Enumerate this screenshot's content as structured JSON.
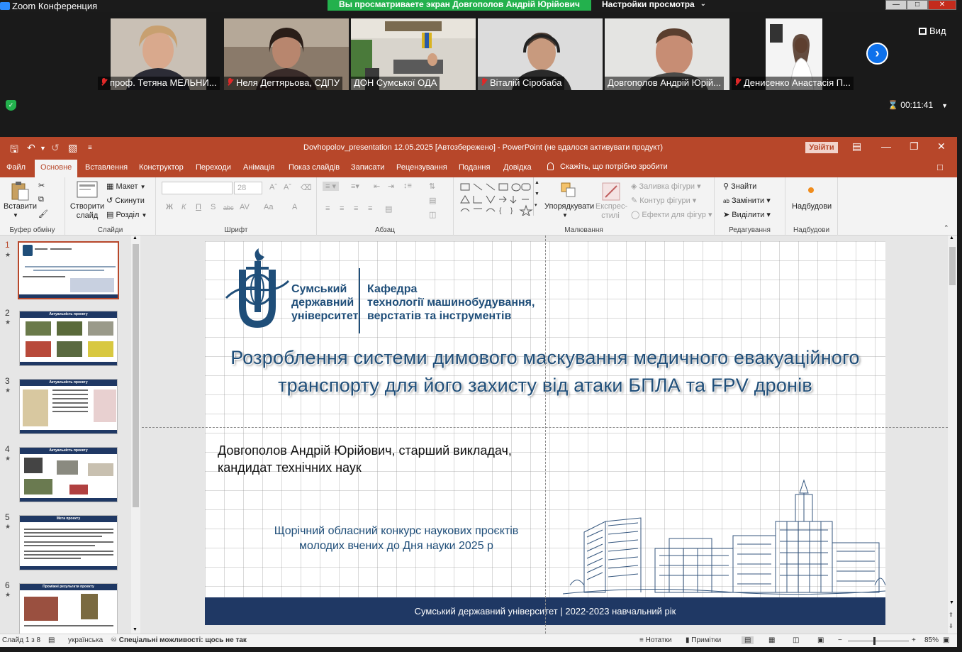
{
  "zoom": {
    "window_title": "Zoom Конференция",
    "share_banner": "Вы просматриваете экран Довгополов Андрій Юрійович",
    "view_options": "Настройки просмотра",
    "view_button": "Вид",
    "timer": "00:11:41",
    "participants": [
      {
        "name": "проф. Тетяна МЕЛЬНИ...",
        "muted": true,
        "active": false
      },
      {
        "name": "Неля Дегтярьова, СДПУ",
        "muted": true,
        "active": false
      },
      {
        "name": "ДОН Сумської ОДА",
        "muted": false,
        "active": false
      },
      {
        "name": "Віталій Сіробаба",
        "muted": true,
        "active": false
      },
      {
        "name": "Довгополов Андрій Юрій...",
        "muted": false,
        "active": true
      },
      {
        "name": "Денисенко Анастасія П...",
        "muted": true,
        "active": false
      }
    ]
  },
  "ppt": {
    "title": "Dovhopolov_presentation 12.05.2025 [Автозбережено]  -  PowerPoint (не вдалося активувати продукт)",
    "signin": "Увійти",
    "tabs": [
      "Файл",
      "Основне",
      "Вставлення",
      "Конструктор",
      "Переходи",
      "Анімація",
      "Показ слайдів",
      "Записати",
      "Рецензування",
      "Подання",
      "Довідка"
    ],
    "active_tab": "Основне",
    "tell_me": "Скажіть, що потрібно зробити",
    "ribbon": {
      "paste": "Вставити",
      "clipboard_group": "Буфер обміну",
      "new_slide": "Створити слайд",
      "layout": "Макет",
      "reset": "Скинути",
      "section": "Розділ",
      "slides_group": "Слайди",
      "font_size": "28",
      "font_group": "Шрифт",
      "paragraph_group": "Абзац",
      "arrange": "Упорядкувати",
      "quick_styles": "Експрес-стилі",
      "shape_fill": "Заливка фігури",
      "shape_outline": "Контур фігури",
      "shape_effects": "Ефекти для фігур",
      "drawing_group": "Малювання",
      "find": "Знайти",
      "replace": "Замінити",
      "select": "Виділити",
      "editing_group": "Редагування",
      "addins": "Надбудови",
      "addins_group": "Надбудови",
      "format_labels": [
        "Ж",
        "К",
        "П",
        "S",
        "abc",
        "AV",
        "Aa",
        "A"
      ]
    },
    "thumbnails": [
      {
        "num": "1",
        "title": ""
      },
      {
        "num": "2",
        "title": "Актуальність проекту"
      },
      {
        "num": "3",
        "title": "Актуальність проекту"
      },
      {
        "num": "4",
        "title": "Актуальність проекту"
      },
      {
        "num": "5",
        "title": "Мета проекту"
      },
      {
        "num": "6",
        "title": "Проміжні результати проекту"
      }
    ],
    "slide": {
      "univ_name": "Сумський державний університет",
      "dept_name_line1": "Кафедра",
      "dept_name_line2": "технології машинобудування,",
      "dept_name_line3": "верстатів та інструментів",
      "title": "Розроблення системи димового маскування медичного евакуаційного транспорту для його захисту від атаки БПЛА та FPV дронів",
      "author_line1": "Довгополов Андрій Юрійович, старший викладач,",
      "author_line2": "кандидат технічних наук",
      "contest_line1": "Щорічний обласний конкурс наукових проєктів",
      "contest_line2": "молодих вчених до Дня науки 2025 р",
      "footer": "Сумський державний університет | 2022-2023 навчальний рік",
      "title_color": "#1f4e79",
      "footer_color": "#1f3864"
    },
    "status": {
      "slide_of": "Слайд 1 з 8",
      "language": "українська",
      "accessibility": "Спеціальні можливості: щось не так",
      "notes": "Нотатки",
      "comments": "Примітки",
      "zoom": "85%"
    },
    "accent_color": "#b7472a"
  }
}
